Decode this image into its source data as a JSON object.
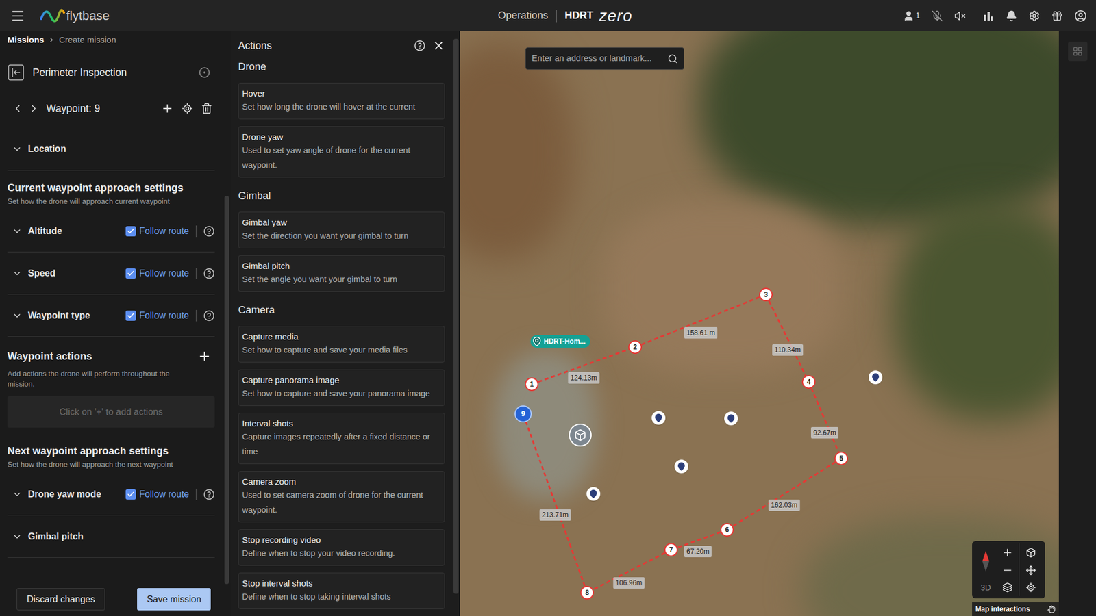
{
  "topbar": {
    "brand": "flytbase",
    "nav": "Operations",
    "org": "HDRT",
    "product": "zero",
    "participants": "1"
  },
  "breadcrumb": [
    {
      "label": "Missions",
      "current": false
    },
    {
      "label": "Create mission",
      "current": true
    }
  ],
  "mission": {
    "name": "Perimeter Inspection"
  },
  "waypoint": {
    "label": "Waypoint: 9"
  },
  "location": {
    "label": "Location",
    "expanded": false
  },
  "current_approach": {
    "title": "Current waypoint approach settings",
    "subtitle": "Set how the drone will approach current waypoint",
    "settings": [
      {
        "label": "Altitude",
        "expanded": false,
        "kind": "checkbox",
        "checked": true,
        "option": "Follow route"
      },
      {
        "label": "Speed",
        "expanded": false,
        "kind": "checkbox",
        "checked": true,
        "option": "Follow route"
      },
      {
        "label": "Waypoint type",
        "expanded": false,
        "kind": "checkbox",
        "checked": true,
        "option": "Follow route"
      }
    ]
  },
  "waypoint_actions": {
    "title": "Waypoint actions",
    "subtitle": "Add actions the drone will perform throughout the mission.",
    "placeholder": "Click on '+' to add actions"
  },
  "next_approach": {
    "title": "Next waypoint approach settings",
    "subtitle": "Set how the drone will approach the next waypoint",
    "settings": [
      {
        "label": "Drone yaw mode",
        "expanded": false,
        "kind": "checkbox",
        "checked": true,
        "option": "Follow route"
      },
      {
        "label": "Gimbal pitch",
        "expanded": false,
        "kind": "plain"
      }
    ]
  },
  "buttons": [
    {
      "label": "Discard changes",
      "primary": false
    },
    {
      "label": "Save mission",
      "primary": true
    }
  ],
  "actions_panel": {
    "title": "Actions",
    "groups": [
      {
        "title": "Drone",
        "items": [
          {
            "title": "Hover",
            "description": "Set how long the drone will hover at the current"
          },
          {
            "title": "Drone yaw",
            "description": "Used to set yaw angle of drone for the current waypoint."
          }
        ]
      },
      {
        "title": "Gimbal",
        "items": [
          {
            "title": "Gimbal yaw",
            "description": "Set the direction you want your gimbal to turn"
          },
          {
            "title": "Gimbal pitch",
            "description": "Set the angle you want your gimbal to turn"
          }
        ]
      },
      {
        "title": "Camera",
        "items": [
          {
            "title": "Capture media",
            "description": "Set how to capture and save your media files"
          },
          {
            "title": "Capture panorama image",
            "description": "Set how to capture and save your panorama image"
          },
          {
            "title": "Interval shots",
            "description": "Capture images repeatedly after a fixed distance or time"
          },
          {
            "title": "Camera zoom",
            "description": "Used to set camera zoom of drone for the current waypoint."
          },
          {
            "title": "Stop recording video",
            "description": "Define when to stop your video recording."
          },
          {
            "title": "Stop interval shots",
            "description": "Define when to stop taking interval shots"
          }
        ]
      }
    ]
  },
  "map": {
    "search_placeholder": "Enter an address or landmark...",
    "home_label": "HDRT-Hom...",
    "waypoints": [
      {
        "label": "1",
        "selected": false
      },
      {
        "label": "2",
        "selected": false
      },
      {
        "label": "3",
        "selected": false
      },
      {
        "label": "4",
        "selected": false
      },
      {
        "label": "5",
        "selected": false
      },
      {
        "label": "6",
        "selected": false
      },
      {
        "label": "7",
        "selected": false
      },
      {
        "label": "8",
        "selected": false
      },
      {
        "label": "9",
        "selected": true
      }
    ],
    "distances": [
      "124.13m",
      "158.61 m",
      "110.34m",
      "92.67m",
      "162.03m",
      "67.20m",
      "106.96m",
      "213.71m"
    ],
    "controls": {
      "view_toggle": "3D",
      "interactions": "Map interactions"
    }
  }
}
